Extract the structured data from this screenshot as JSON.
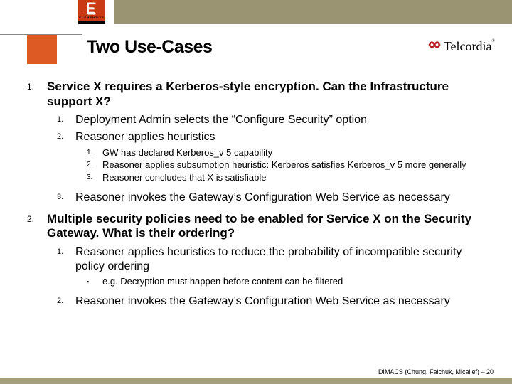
{
  "brand": {
    "elementive": "ELEMENTIVE",
    "telcordia": "Telcordia"
  },
  "title": "Two Use-Cases",
  "items": {
    "i1": {
      "num": "1.",
      "text": "Service X requires a Kerberos-style encryption. Can the Infrastructure support X?",
      "sub": {
        "s1": {
          "num": "1.",
          "text": "Deployment Admin selects the “Configure Security” option"
        },
        "s2": {
          "num": "2.",
          "text": "Reasoner applies heuristics",
          "sub": {
            "a": {
              "num": "1.",
              "text": "GW has declared Kerberos_v 5 capability"
            },
            "b": {
              "num": "2.",
              "text": "Reasoner applies subsumption heuristic: Kerberos satisfies Kerberos_v 5 more generally"
            },
            "c": {
              "num": "3.",
              "text": "Reasoner concludes that X is satisfiable"
            }
          }
        },
        "s3": {
          "num": "3.",
          "text": "Reasoner invokes the Gateway’s Configuration Web Service as necessary"
        }
      }
    },
    "i2": {
      "num": "2.",
      "text": "Multiple security policies need to be enabled for Service X on the Security Gateway. What is their ordering?",
      "sub": {
        "s1": {
          "num": "1.",
          "text": "Reasoner applies heuristics to reduce the probability of incompatible security policy ordering",
          "sub": {
            "a": {
              "bullet": "▪",
              "text": "e.g. Decryption must happen before content can be filtered"
            }
          }
        },
        "s2": {
          "num": "2.",
          "text": "Reasoner invokes the Gateway’s Configuration Web Service as necessary"
        }
      }
    }
  },
  "footer": "DIMACS (Chung, Falchuk, Micallef) – 20"
}
